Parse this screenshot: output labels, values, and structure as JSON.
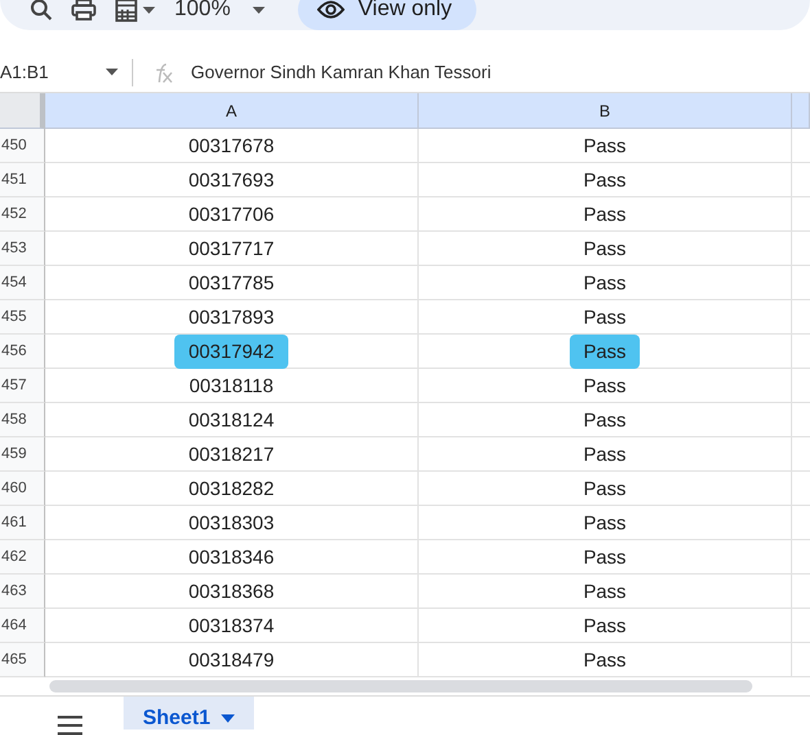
{
  "toolbar": {
    "zoom": "100%",
    "mode_button": "View only"
  },
  "formula_bar": {
    "name_box": "A1:B1",
    "formula": "Governor Sindh Kamran Khan Tessori"
  },
  "columns": [
    "A",
    "B"
  ],
  "rows": [
    {
      "number": "450",
      "a": "00317678",
      "b": "Pass",
      "highlighted": false
    },
    {
      "number": "451",
      "a": "00317693",
      "b": "Pass",
      "highlighted": false
    },
    {
      "number": "452",
      "a": "00317706",
      "b": "Pass",
      "highlighted": false
    },
    {
      "number": "453",
      "a": "00317717",
      "b": "Pass",
      "highlighted": false
    },
    {
      "number": "454",
      "a": "00317785",
      "b": "Pass",
      "highlighted": false
    },
    {
      "number": "455",
      "a": "00317893",
      "b": "Pass",
      "highlighted": false
    },
    {
      "number": "456",
      "a": "00317942",
      "b": "Pass",
      "highlighted": true
    },
    {
      "number": "457",
      "a": "00318118",
      "b": "Pass",
      "highlighted": false
    },
    {
      "number": "458",
      "a": "00318124",
      "b": "Pass",
      "highlighted": false
    },
    {
      "number": "459",
      "a": "00318217",
      "b": "Pass",
      "highlighted": false
    },
    {
      "number": "460",
      "a": "00318282",
      "b": "Pass",
      "highlighted": false
    },
    {
      "number": "461",
      "a": "00318303",
      "b": "Pass",
      "highlighted": false
    },
    {
      "number": "462",
      "a": "00318346",
      "b": "Pass",
      "highlighted": false
    },
    {
      "number": "463",
      "a": "00318368",
      "b": "Pass",
      "highlighted": false
    },
    {
      "number": "464",
      "a": "00318374",
      "b": "Pass",
      "highlighted": false
    },
    {
      "number": "465",
      "a": "00318479",
      "b": "Pass",
      "highlighted": false
    }
  ],
  "sheet_tabs": [
    {
      "label": "Sheet1",
      "selected": true
    }
  ]
}
